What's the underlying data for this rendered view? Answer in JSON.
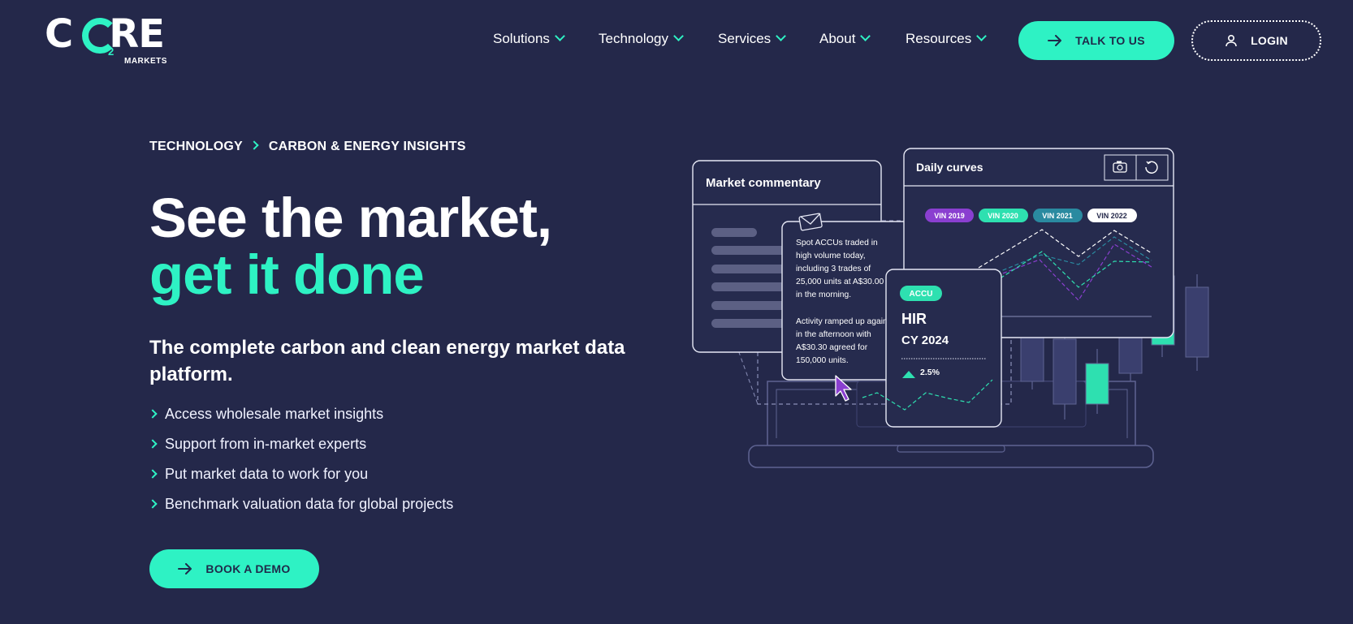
{
  "brand": {
    "logo_word": "CORE",
    "logo_sub": "2",
    "logo_tagline": "MARKETS"
  },
  "nav": {
    "items": [
      {
        "label": "Solutions"
      },
      {
        "label": "Technology"
      },
      {
        "label": "Services"
      },
      {
        "label": "About"
      },
      {
        "label": "Resources"
      }
    ],
    "talk_label": "TALK TO US",
    "login_label": "LOGIN"
  },
  "breadcrumb": {
    "parent": "TECHNOLOGY",
    "current": "CARBON & ENERGY INSIGHTS"
  },
  "hero": {
    "headline_plain": "See the market, ",
    "headline_accent": "get it done",
    "subhead": "The complete carbon and clean energy market data platform.",
    "features": [
      "Access wholesale market insights",
      "Support from in-market experts",
      "Put market data to work for you",
      "Benchmark valuation data for global projects"
    ],
    "cta_label": "BOOK A DEMO"
  },
  "illustration": {
    "commentary_title": "Market commentary",
    "message_lines_1": [
      "Spot ACCUs traded in",
      "high volume today,",
      "including 3 trades of",
      "25,000 units at A$30.00",
      "in the morning."
    ],
    "message_lines_2": [
      "Activity ramped up again",
      "in the afternoon with",
      "A$30.30 agreed for",
      "150,000 units."
    ],
    "curves_title": "Daily curves",
    "vintages": [
      {
        "label": "VIN 2019",
        "color": "#8a3fd0"
      },
      {
        "label": "VIN 2020",
        "color": "#2ee0b0"
      },
      {
        "label": "VIN 2021",
        "color": "#2a8aa0"
      },
      {
        "label": "VIN 2022",
        "color": "#ffffff"
      }
    ],
    "card_badge": "ACCU",
    "card_title": "HIR",
    "card_sub": "CY 2024",
    "card_change": "2.5%"
  },
  "colors": {
    "background": "#24284a",
    "accent": "#2ef2c4",
    "panel": "#262b4e",
    "candle_neutral": "#3a3f6e"
  },
  "icons": {
    "talk": "arrow-right-icon",
    "login": "user-icon",
    "demo": "arrow-right-icon",
    "camera": "camera-icon",
    "refresh": "refresh-icon",
    "message": "envelope-icon",
    "cursor": "pointer-cursor-icon",
    "trend": "triangle-up-icon"
  }
}
